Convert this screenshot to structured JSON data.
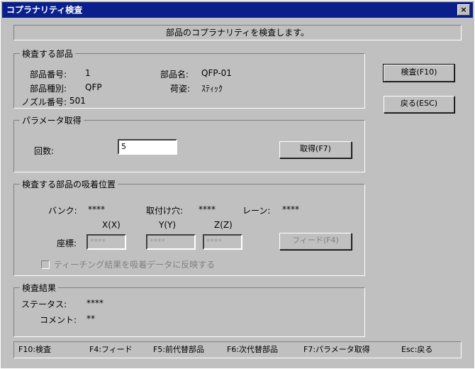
{
  "window": {
    "title": "コプラナリティ検査",
    "close_label": "×"
  },
  "message": "部品のコプラナリティを検査します。",
  "part_group": {
    "title": "検査する部品",
    "part_number_label": "部品番号:",
    "part_number_value": "1",
    "part_name_label": "部品名:",
    "part_name_value": "QFP-01",
    "part_type_label": "部品種別:",
    "part_type_value": "QFP",
    "shape_label": "荷姿:",
    "shape_value": "ｽﾃｨｯｸ",
    "nozzle_label": "ノズル番号:",
    "nozzle_value": "501"
  },
  "param_group": {
    "title": "パラメータ取得",
    "count_label": "回数:",
    "count_value": "5",
    "acquire_button": "取得(F7)"
  },
  "position_group": {
    "title": "検査する部品の吸着位置",
    "bank_label": "バンク:",
    "bank_value": "****",
    "fixture_label": "取付け穴:",
    "fixture_value": "****",
    "lane_label": "レーン:",
    "lane_value": "****",
    "x_label": "X(X)",
    "y_label": "Y(Y)",
    "z_label": "Z(Z)",
    "coord_label": "座標:",
    "x_value": "****",
    "y_value": "****",
    "z_value": "****",
    "feed_button": "フィード(F4)",
    "reflect_checkbox_label": "ティーチング結果を吸着データに反映する"
  },
  "result_group": {
    "title": "検査結果",
    "status_label": "ステータス:",
    "status_value": "****",
    "comment_label": "コメント:",
    "comment_value": "**"
  },
  "buttons": {
    "inspect": "検査(F10)",
    "back": "戻る(ESC)"
  },
  "statusbar": {
    "f10": "F10:検査",
    "f4": "F4:フィード",
    "f5": "F5:前代替部品",
    "f6": "F6:次代替部品",
    "f7": "F7:パラメータ取得",
    "esc": "Esc:戻る"
  }
}
